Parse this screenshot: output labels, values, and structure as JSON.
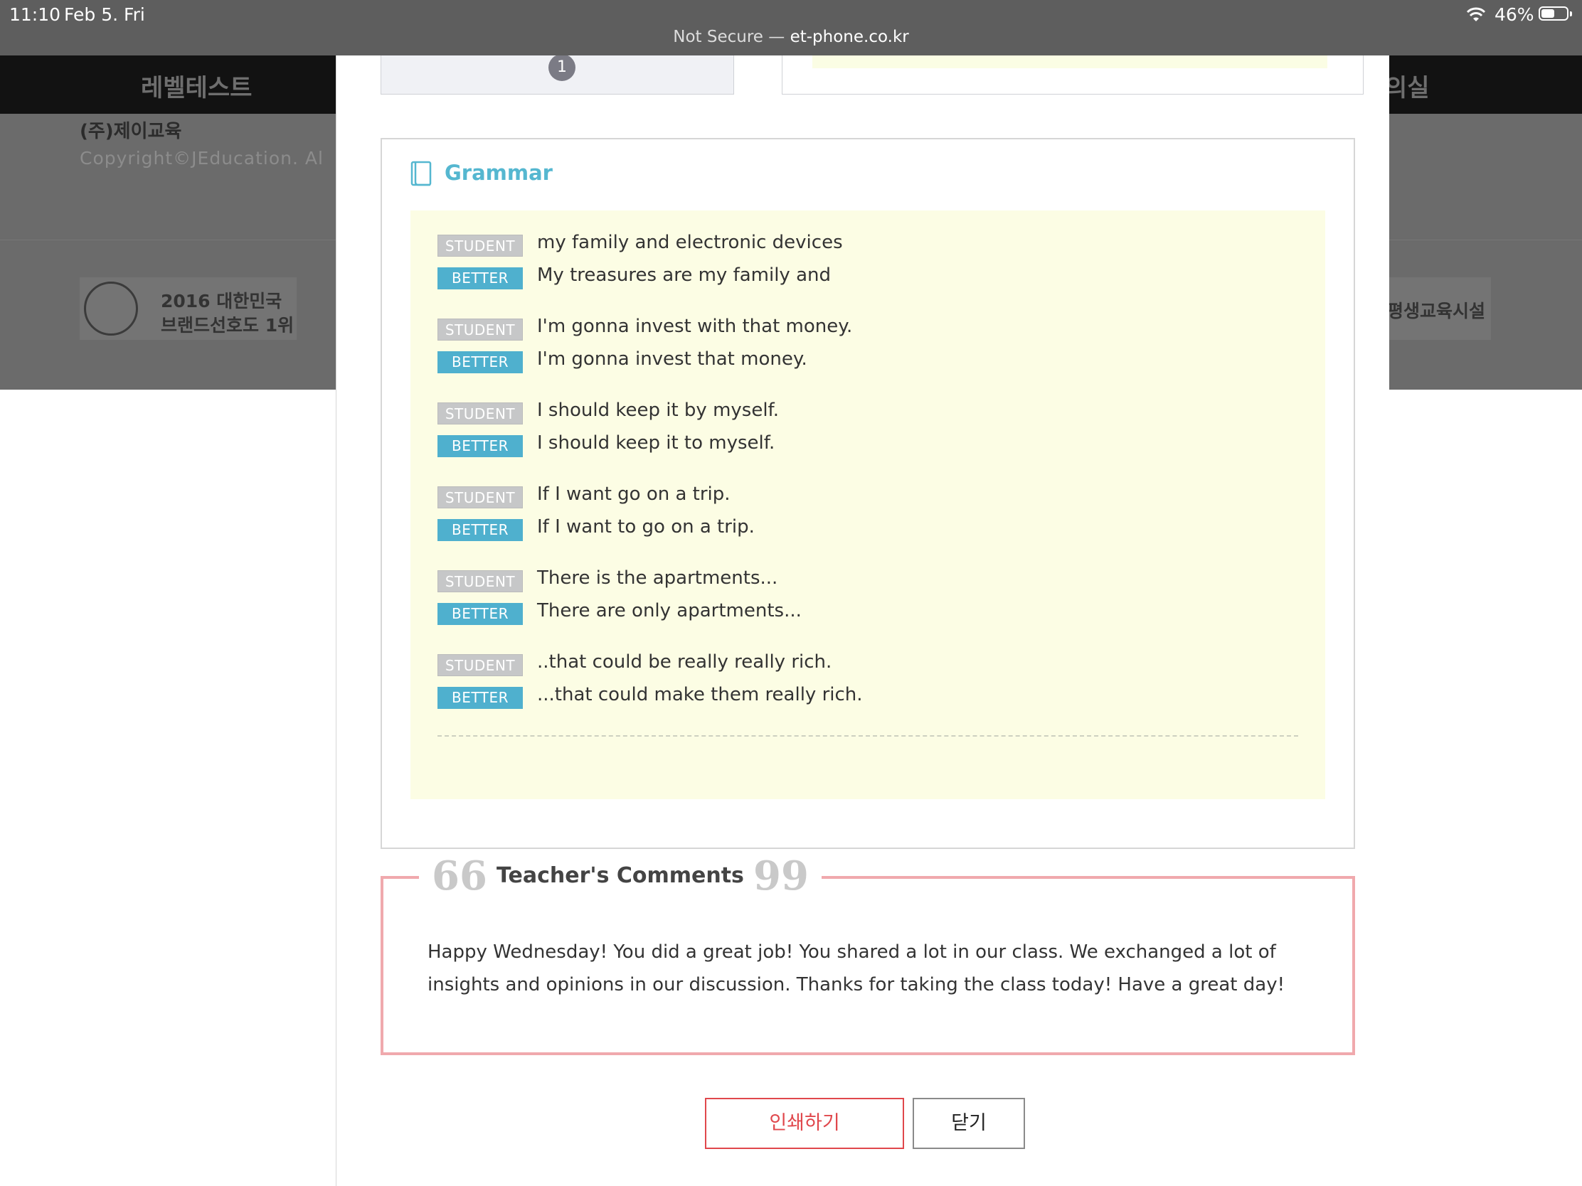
{
  "status_bar": {
    "time": "11:10",
    "date": "Feb 5. Fri",
    "battery": "46%",
    "url_prefix": "Not Secure — ",
    "url_domain": "et-phone.co.kr"
  },
  "background_site": {
    "nav_left": "레벨테스트",
    "nav_right": "의실",
    "company": "(주)제이교육",
    "copyright": "Copyright©JEducation. Al",
    "award_line1": "2016 대한민국",
    "award_line2": "브랜드선호도 1위",
    "lifelong": "평생교육시설"
  },
  "prev_section": {
    "page_number": "1"
  },
  "grammar": {
    "title": "Grammar",
    "student_label": "STUDENT",
    "better_label": "BETTER",
    "pairs": [
      {
        "student": "my family and electronic devices",
        "better": "My treasures are my family and"
      },
      {
        "student": "I'm gonna invest with that money.",
        "better": "I'm gonna invest that money."
      },
      {
        "student": "I should keep it by myself.",
        "better": "I should keep it to myself."
      },
      {
        "student": "If I want go on a trip.",
        "better": "If I want to go on a trip."
      },
      {
        "student": "There is the apartments...",
        "better": "There are only apartments..."
      },
      {
        "student": "..that could be really really rich.",
        "better": "...that could make them really rich."
      }
    ]
  },
  "comments": {
    "title": "Teacher's Comments",
    "open_quote": "66",
    "close_quote": "99",
    "text": "Happy Wednesday! You did a great job! You shared a lot in our class. We exchanged a lot of insights and opinions in our discussion. Thanks for taking the class today! Have a great day!"
  },
  "buttons": {
    "print": "인쇄하기",
    "close": "닫기"
  },
  "colors": {
    "accent_blue": "#4fb0ce",
    "grammar_title": "#55b7d0",
    "comment_border": "#f0a9ad",
    "print_red": "#e0474c",
    "yellow_bg": "#fcfde4"
  }
}
